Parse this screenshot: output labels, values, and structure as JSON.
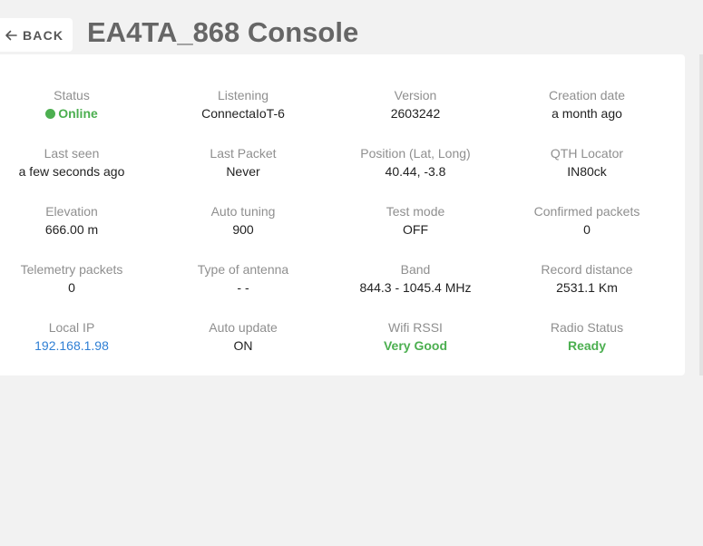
{
  "header": {
    "back_label": "BACK",
    "title": "EA4TA_868 Console"
  },
  "colors": {
    "online": "#4caf50",
    "good": "#4caf50",
    "link": "#2f7fd4"
  },
  "fields": {
    "status": {
      "label": "Status",
      "value": "Online"
    },
    "listening": {
      "label": "Listening",
      "value": "ConnectaIoT-6"
    },
    "version": {
      "label": "Version",
      "value": "2603242"
    },
    "creation_date": {
      "label": "Creation date",
      "value": "a month ago"
    },
    "last_seen": {
      "label": "Last seen",
      "value": "a few seconds ago"
    },
    "last_packet": {
      "label": "Last Packet",
      "value": "Never"
    },
    "position": {
      "label": "Position (Lat, Long)",
      "value": "40.44, -3.8"
    },
    "qth_locator": {
      "label": "QTH Locator",
      "value": "IN80ck"
    },
    "elevation": {
      "label": "Elevation",
      "value": "666.00 m"
    },
    "auto_tuning": {
      "label": "Auto tuning",
      "value": "900"
    },
    "test_mode": {
      "label": "Test mode",
      "value": "OFF"
    },
    "confirmed_packets": {
      "label": "Confirmed packets",
      "value": "0"
    },
    "telemetry_packets": {
      "label": "Telemetry packets",
      "value": "0"
    },
    "antenna_type": {
      "label": "Type of antenna",
      "value": "- -"
    },
    "band": {
      "label": "Band",
      "value": "844.3 - 1045.4 MHz"
    },
    "record_distance": {
      "label": "Record distance",
      "value": "2531.1 Km"
    },
    "local_ip": {
      "label": "Local IP",
      "value": "192.168.1.98"
    },
    "auto_update": {
      "label": "Auto update",
      "value": "ON"
    },
    "wifi_rssi": {
      "label": "Wifi RSSI",
      "value": "Very Good"
    },
    "radio_status": {
      "label": "Radio Status",
      "value": "Ready"
    }
  }
}
